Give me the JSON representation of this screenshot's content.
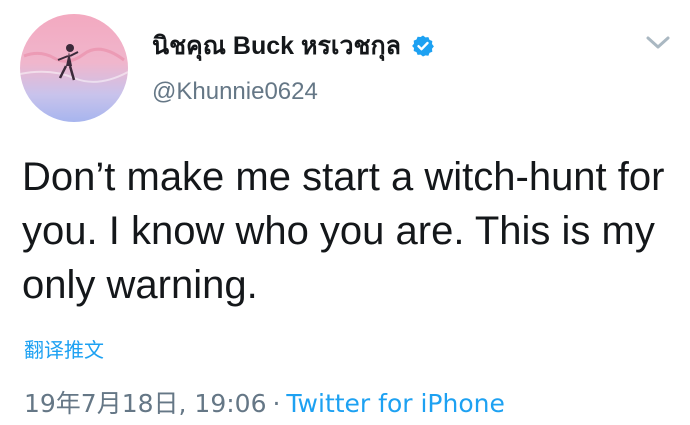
{
  "author": {
    "display_name": "นิชคุณ Buck หรเวชกุล",
    "handle": "@Khunnie0624",
    "verified": true,
    "avatar_icon": "profile-photo"
  },
  "tweet": {
    "text": "Don’t make me start a witch-hunt for you. I know who you are. This is my only warning.",
    "translate_label": "翻译推文",
    "timestamp": "19年7月18日, 19:06",
    "separator": "·",
    "source": "Twitter for iPhone"
  },
  "icons": {
    "verified": "verified-badge-icon",
    "menu": "chevron-down-icon"
  },
  "colors": {
    "link": "#1da1f2",
    "muted": "#657786",
    "text": "#14171a"
  }
}
